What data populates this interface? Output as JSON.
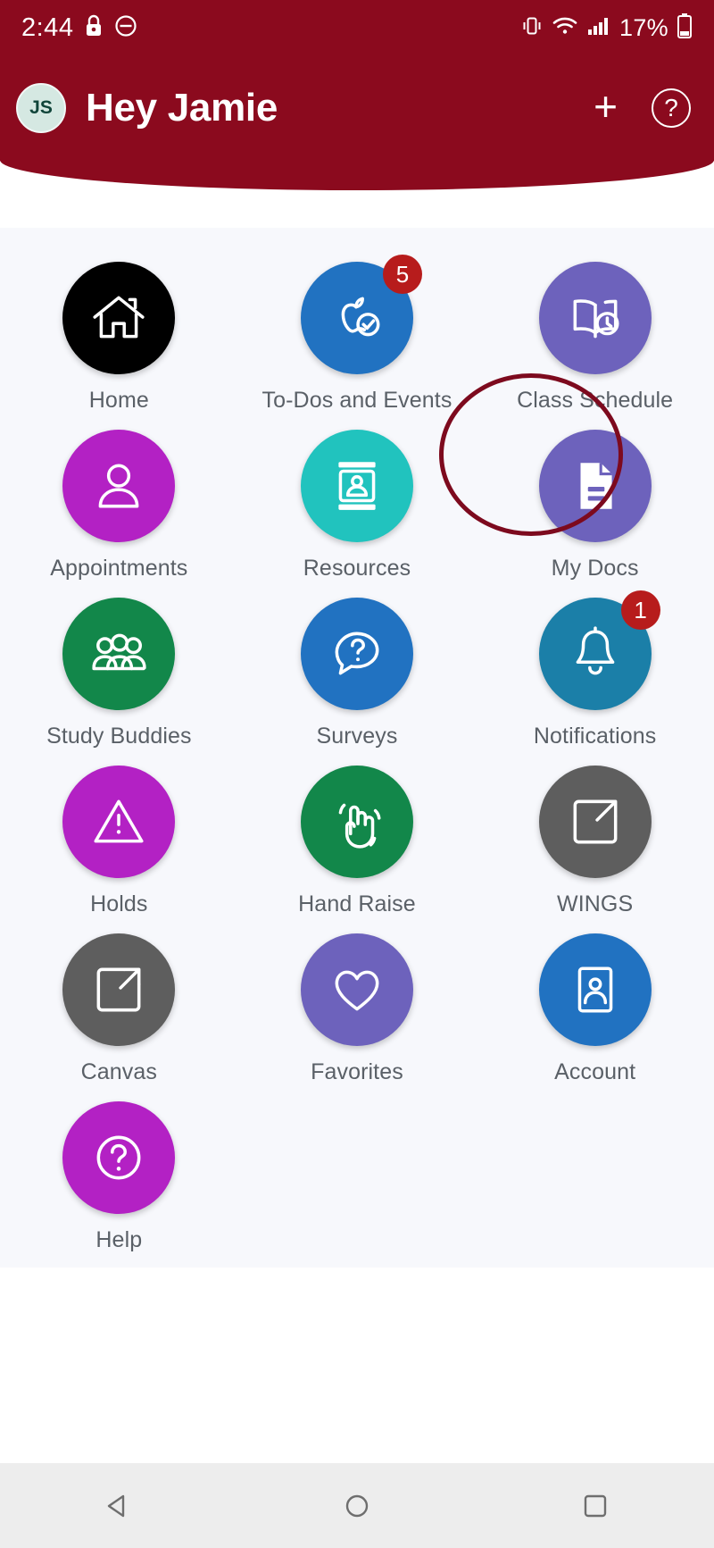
{
  "status_bar": {
    "time": "2:44",
    "lock_icon": "lock-icon",
    "dnd_icon": "do-not-disturb-icon",
    "vibrate_icon": "vibrate-icon",
    "wifi_icon": "wifi-icon",
    "signal_icon": "cellular-signal-icon",
    "battery_percent": "17%",
    "battery_icon": "battery-icon",
    "background_color": "#8B0A1E"
  },
  "header": {
    "avatar_initials": "JS",
    "title": "Hey Jamie",
    "add_label": "+",
    "help_label": "?",
    "background_color": "#8B0A1E"
  },
  "grid": {
    "tiles": [
      {
        "label": "Home",
        "icon": "home-icon",
        "color": "#000000",
        "badge": null
      },
      {
        "label": "To-Dos and Events",
        "icon": "apple-check-icon",
        "color": "#2172C1",
        "badge": "5"
      },
      {
        "label": "Class Schedule",
        "icon": "book-clock-icon",
        "color": "#6D62BC",
        "badge": null
      },
      {
        "label": "Appointments",
        "icon": "person-icon",
        "color": "#B321C4",
        "badge": null
      },
      {
        "label": "Resources",
        "icon": "id-card-icon",
        "color": "#21C3BE",
        "badge": null
      },
      {
        "label": "My Docs",
        "icon": "document-icon",
        "color": "#6D62BC",
        "badge": null
      },
      {
        "label": "Study Buddies",
        "icon": "people-group-icon",
        "color": "#12874A",
        "badge": null
      },
      {
        "label": "Surveys",
        "icon": "question-bubble-icon",
        "color": "#2172C1",
        "badge": null
      },
      {
        "label": "Notifications",
        "icon": "bell-icon",
        "color": "#1B7FA8",
        "badge": "1"
      },
      {
        "label": "Holds",
        "icon": "warning-triangle-icon",
        "color": "#B321C4",
        "badge": null
      },
      {
        "label": "Hand Raise",
        "icon": "raised-hand-icon",
        "color": "#12874A",
        "badge": null
      },
      {
        "label": "WINGS",
        "icon": "external-link-icon",
        "color": "#5E5E5E",
        "badge": null
      },
      {
        "label": "Canvas",
        "icon": "external-link-icon",
        "color": "#5E5E5E",
        "badge": null
      },
      {
        "label": "Favorites",
        "icon": "heart-icon",
        "color": "#6D62BC",
        "badge": null
      },
      {
        "label": "Account",
        "icon": "contact-card-icon",
        "color": "#2172C1",
        "badge": null
      },
      {
        "label": "Help",
        "icon": "question-circle-icon",
        "color": "#B321C4",
        "badge": null
      }
    ],
    "highlight": {
      "tile_label": "My Docs",
      "color": "#7D0A1E"
    },
    "background_color": "#F7F8FC"
  },
  "system_nav": {
    "back_label": "back-button",
    "home_label": "home-button",
    "recents_label": "recents-button"
  }
}
